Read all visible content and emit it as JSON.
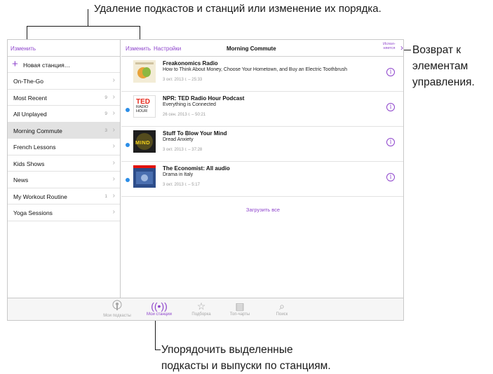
{
  "callouts": {
    "top": "Удаление подкастов и станций или изменение их порядка.",
    "right_lines": [
      "Возврат к",
      "элементам",
      "управления."
    ],
    "bottom_lines": [
      "Упорядочить выделенные",
      "подкасты и выпуски по станциям."
    ]
  },
  "sidebar": {
    "edit_label": "Изменить",
    "new_station": "Новая станция…",
    "stations": [
      {
        "label": "On-The-Go",
        "count": ""
      },
      {
        "label": "Most Recent",
        "count": "9"
      },
      {
        "label": "All Unplayed",
        "count": "9"
      },
      {
        "label": "Morning Commute",
        "count": "3"
      },
      {
        "label": "French Lessons",
        "count": ""
      },
      {
        "label": "Kids Shows",
        "count": ""
      },
      {
        "label": "News",
        "count": ""
      },
      {
        "label": "My Workout Routine",
        "count": "1"
      },
      {
        "label": "Yoga Sessions",
        "count": ""
      }
    ],
    "selected_station": "Morning Commute"
  },
  "main": {
    "edit_label": "Изменить",
    "settings_label": "Настройки",
    "title": "Morning Commute",
    "now_playing_lines": [
      "Испол-",
      "няется"
    ],
    "episodes": [
      {
        "title": "Freakonomics Radio",
        "subtitle": "How to Think About Money, Choose Your Hometown, and Buy an Electric Toothbrush",
        "date": "3 окт. 2013 г. – 25:33",
        "unplayed": false,
        "art": "freakonomics-artwork"
      },
      {
        "title": "NPR: TED Radio Hour Podcast",
        "subtitle": "Everything is Connected",
        "date": "26 сен. 2013 г. – 50:21",
        "unplayed": true,
        "art": "ted-radio-hour-artwork",
        "art_text_1": "TED",
        "art_text_2": "RADIO HOUR"
      },
      {
        "title": "Stuff To Blow Your Mind",
        "subtitle": "Dread Anxiety",
        "date": "3 окт. 2013 г. – 37:28",
        "unplayed": true,
        "art": "stuff-to-blow-your-mind-artwork",
        "art_text": "MIND"
      },
      {
        "title": "The Economist: All audio",
        "subtitle": "Drama in Italy",
        "date": "3 окт. 2013 г. – 5:17",
        "unplayed": true,
        "art": "economist-artwork"
      }
    ],
    "download_all": "Загрузить все"
  },
  "tabbar": {
    "tabs": [
      {
        "label": "Мои подкасты",
        "icon": "podcast-icon",
        "active": false
      },
      {
        "label": "Мои станции",
        "icon": "station-icon",
        "active": true
      },
      {
        "label": "Подборка",
        "icon": "star-icon",
        "active": false
      },
      {
        "label": "Топ-чарты",
        "icon": "list-icon",
        "active": false
      },
      {
        "label": "Поиск",
        "icon": "search-icon",
        "active": false
      }
    ]
  },
  "colors": {
    "accent": "#8e44cc",
    "unplayed_dot": "#2c8ee8",
    "selected_row": "#e2e2e2"
  }
}
